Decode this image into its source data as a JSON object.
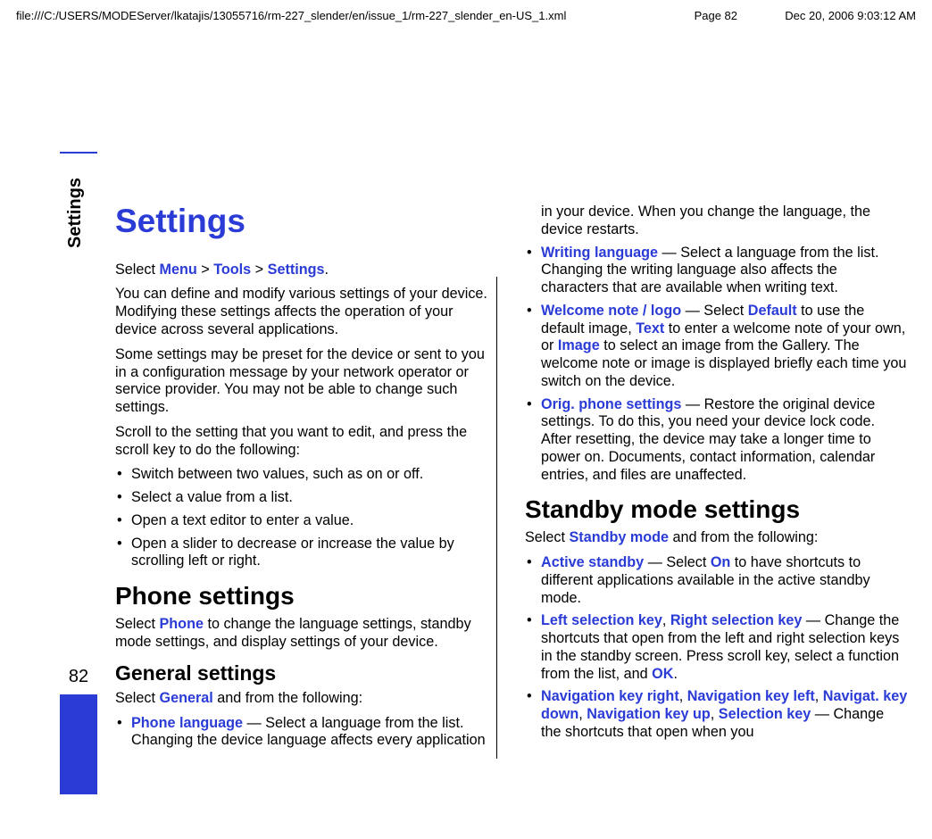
{
  "header": {
    "path": "file:///C:/USERS/MODEServer/lkatajis/13055716/rm-227_slender/en/issue_1/rm-227_slender_en-US_1.xml",
    "page": "Page 82",
    "date": "Dec 20, 2006 9:03:12 AM"
  },
  "tab": {
    "label": "Settings",
    "page_number": "82"
  },
  "body": {
    "h1": "Settings",
    "intro_select": {
      "pre": "Select ",
      "menu": "Menu",
      "gt1": " > ",
      "tools": "Tools",
      "gt2": " > ",
      "settings": "Settings",
      "post": "."
    },
    "p1": "You can define and modify various settings of your device. Modifying these settings affects the operation of your device across several applications.",
    "p2": "Some settings may be preset for the device or sent to you in a configuration message by your network operator or service provider. You may not be able to change such settings.",
    "p3": "Scroll to the setting that you want to edit, and press the scroll key to do the following:",
    "scroll_list": [
      "Switch between two values, such as on or off.",
      "Select a value from a list.",
      "Open a text editor to enter a value.",
      "Open a slider to decrease or increase the value by scrolling left or right."
    ],
    "h2_phone": "Phone settings",
    "phone_p": {
      "pre": "Select ",
      "phone": "Phone",
      "post": " to change the language settings, standby mode settings, and display settings of your device."
    },
    "h3_general": "General settings",
    "general_p": {
      "pre": "Select ",
      "general": "General",
      "post": " and from the following:"
    },
    "general_list": {
      "i1": {
        "label": "Phone language",
        "text": " — Select a language from the list. Changing the device language affects every application in your device. When you change the language, the device restarts."
      },
      "i2": {
        "label": "Writing language",
        "text": " — Select a language from the list. Changing the writing language also affects the characters that are available when writing text."
      },
      "i3": {
        "label": "Welcome note / logo",
        "pre": " — Select ",
        "default": "Default",
        "t1": " to use the default image, ",
        "textlbl": "Text",
        "t2": " to enter a welcome note of your own, or ",
        "image": "Image",
        "t3": " to select an image from the Gallery. The welcome note or image is displayed briefly each time you switch on the device."
      },
      "i4": {
        "label": "Orig. phone settings",
        "text": " — Restore the original device settings. To do this, you need your device lock code. After resetting, the device may take a longer time to power on. Documents, contact information, calendar entries, and files are unaffected."
      }
    },
    "h2_standby": "Standby mode settings",
    "standby_p": {
      "pre": "Select ",
      "standby": "Standby mode",
      "post": " and from the following:"
    },
    "standby_list": {
      "i1": {
        "label": "Active standby",
        "pre": " — Select ",
        "on": "On",
        "text": " to have shortcuts to different applications available in the active standby mode."
      },
      "i2": {
        "lsk": "Left selection key",
        "sep": ", ",
        "rsk": "Right selection key",
        "pre": " — Change the shortcuts that open from the left and right selection keys in the standby screen. Press scroll key, select a function from the list, and ",
        "ok": "OK",
        "post": "."
      },
      "i3": {
        "nkr": "Navigation key right",
        "s1": ", ",
        "nkl": "Navigation key left",
        "s2": ", ",
        "nkd": "Navigat. key down",
        "s3": ", ",
        "nku": "Navigation key up",
        "s4": ", ",
        "sel": "Selection key",
        "text": " — Change the shortcuts that open when you"
      }
    }
  }
}
